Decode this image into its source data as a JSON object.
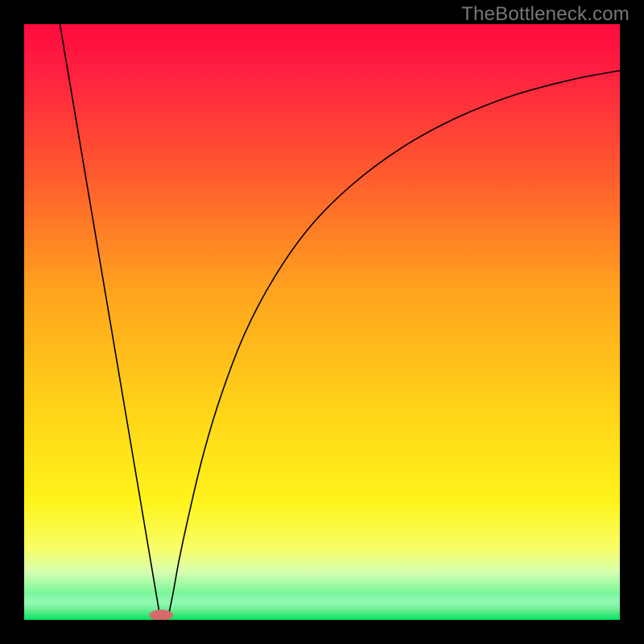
{
  "watermark": "TheBottleneck.com",
  "chart_data": {
    "type": "line",
    "title": "",
    "xlabel": "",
    "ylabel": "",
    "xlim": [
      0,
      100
    ],
    "ylim": [
      0,
      100
    ],
    "background_gradient": {
      "stops": [
        {
          "offset": 0.0,
          "color": "#ff0a3e"
        },
        {
          "offset": 0.08,
          "color": "#ff2040"
        },
        {
          "offset": 0.25,
          "color": "#ff5a2e"
        },
        {
          "offset": 0.45,
          "color": "#ffa41e"
        },
        {
          "offset": 0.65,
          "color": "#ffd418"
        },
        {
          "offset": 0.8,
          "color": "#fff31b"
        },
        {
          "offset": 0.88,
          "color": "#f8ff66"
        },
        {
          "offset": 0.92,
          "color": "#d6ffb0"
        },
        {
          "offset": 0.96,
          "color": "#6cf598"
        },
        {
          "offset": 1.0,
          "color": "#00e663"
        }
      ]
    },
    "green_band": {
      "y0": 95.5,
      "y1": 100
    },
    "marker": {
      "x": 23,
      "y": 99.2,
      "rx": 2.0,
      "ry": 0.9,
      "fill": "#d66a6a"
    },
    "series": [
      {
        "name": "left-line",
        "type": "segment",
        "p0": {
          "x": 6,
          "y": 0
        },
        "p1": {
          "x": 22.8,
          "y": 99.4
        },
        "stroke": "#000000",
        "w": 1.6
      },
      {
        "name": "right-curve",
        "type": "curve",
        "points": [
          {
            "x": 24.2,
            "y": 99.4
          },
          {
            "x": 25.0,
            "y": 95.5
          },
          {
            "x": 26.0,
            "y": 90.0
          },
          {
            "x": 27.5,
            "y": 83.0
          },
          {
            "x": 30.0,
            "y": 72.5
          },
          {
            "x": 33.0,
            "y": 62.5
          },
          {
            "x": 37.0,
            "y": 52.0
          },
          {
            "x": 42.0,
            "y": 42.5
          },
          {
            "x": 48.0,
            "y": 34.0
          },
          {
            "x": 55.0,
            "y": 27.0
          },
          {
            "x": 63.0,
            "y": 21.0
          },
          {
            "x": 72.0,
            "y": 16.0
          },
          {
            "x": 82.0,
            "y": 12.0
          },
          {
            "x": 92.0,
            "y": 9.3
          },
          {
            "x": 100.0,
            "y": 7.8
          }
        ],
        "stroke": "#000000",
        "w": 1.6
      }
    ]
  }
}
